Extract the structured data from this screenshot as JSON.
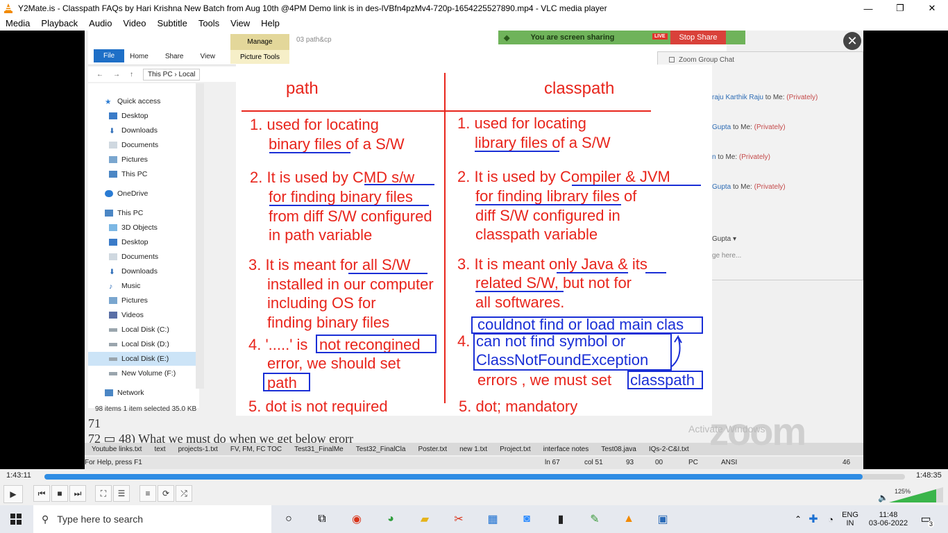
{
  "window": {
    "title": "Y2Mate.is - Classpath FAQs by Hari Krishna  New Batch from Aug 10th @4PM  Demo link is in des-lVBfn4pzMv4-720p-1654225527890.mp4 - VLC media player",
    "minimize": "—",
    "maximize": "❐",
    "close": "✕"
  },
  "menu": [
    "Media",
    "Playback",
    "Audio",
    "Video",
    "Subtitle",
    "Tools",
    "View",
    "Help"
  ],
  "explorer": {
    "manage": "Manage",
    "picture_tools": "Picture Tools",
    "folder_title": "03 path&cp",
    "tabs": [
      "File",
      "Home",
      "Share",
      "View"
    ],
    "address": [
      "This PC",
      "Local"
    ],
    "nav_items": [
      {
        "label": "Quick access",
        "icon": "star-icon"
      },
      {
        "label": "Desktop",
        "icon": "desktop-icon"
      },
      {
        "label": "Downloads",
        "icon": "download-icon"
      },
      {
        "label": "Documents",
        "icon": "document-icon"
      },
      {
        "label": "Pictures",
        "icon": "pictures-icon"
      },
      {
        "label": "This PC",
        "icon": "pc-icon"
      },
      {
        "label": "OneDrive",
        "icon": "cloud-icon"
      },
      {
        "label": "This PC",
        "icon": "pc-icon"
      },
      {
        "label": "3D Objects",
        "icon": "cube-icon"
      },
      {
        "label": "Desktop",
        "icon": "desktop-icon"
      },
      {
        "label": "Documents",
        "icon": "document-icon"
      },
      {
        "label": "Downloads",
        "icon": "download-icon"
      },
      {
        "label": "Music",
        "icon": "music-icon"
      },
      {
        "label": "Pictures",
        "icon": "pictures-icon"
      },
      {
        "label": "Videos",
        "icon": "video-icon"
      },
      {
        "label": "Local Disk (C:)",
        "icon": "disk-icon"
      },
      {
        "label": "Local Disk (D:)",
        "icon": "disk-icon"
      },
      {
        "label": "Local Disk (E:)",
        "icon": "disk-icon"
      },
      {
        "label": "New Volume (F:)",
        "icon": "disk-icon"
      },
      {
        "label": "Network",
        "icon": "network-icon"
      }
    ],
    "status": "98 items     1 item selected  35.0 KB"
  },
  "notepad": {
    "line_71": "71",
    "line_72": "72 ▭ 48) What we must do when we get below erorr",
    "tabs": [
      "Youtube links.txt",
      "text",
      "projects-1.txt",
      "FV, FM, FC TOC",
      "Test31_FinalMe",
      "Test32_FinalCla",
      "Poster.txt",
      "new 1.txt",
      "Project.txt",
      "interface notes",
      "Test08.java",
      "IQs-2-C&I.txt"
    ],
    "help": "For Help, press F1",
    "ln": "ln 67",
    "col": "col 51",
    "n93": "93",
    "n00": "00",
    "pc": "PC",
    "ansi": "ANSI",
    "n46": "46"
  },
  "zoom": {
    "sharing": "You are screen sharing",
    "live": "LIVE",
    "stop_share": "Stop Share",
    "close": "✕",
    "chat_title": "Zoom Group Chat",
    "messages": [
      {
        "from": "raju Karthik Raju",
        "to": "to Me:",
        "tag": "(Privately)"
      },
      {
        "from": "Gupta",
        "to": "to Me:",
        "tag": "(Privately)"
      },
      {
        "from": "n",
        "to": "to Me:",
        "tag": "(Privately)"
      },
      {
        "from": "Gupta",
        "to": "to Me:",
        "tag": "(Privately)"
      }
    ],
    "recipient": "Gupta ▾",
    "type_here": "ge here...",
    "logo": "zoom",
    "activate": "Activate Windows"
  },
  "board": {
    "head_left": "path",
    "head_right": "classpath",
    "left": [
      "1. used for locating",
      "binary files of a S/W",
      "2. It is used by CMD s/w",
      "for finding binary files",
      "from diff S/W configured",
      "in path variable",
      "3. It is meant for all S/W",
      "installed in our computer",
      "including OS for",
      "finding binary files",
      "4. '.....' is",
      "not recongined",
      "error, we should set",
      "path",
      "5. dot is not required"
    ],
    "right": [
      "1. used for locating",
      "library files of a S/W",
      "2. It is used by Compiler & JVM",
      "for finding library files of",
      "diff S/W configured in",
      "classpath variable",
      "3. It is meant only Java & its",
      "related S/W, but not for",
      "all softwares.",
      "couldnot find or load main clas",
      "4.",
      "can not find symbol   or",
      "ClassNotFoundException",
      "errors , we must set",
      "classpath",
      "5. dot;  mandatory"
    ]
  },
  "player": {
    "elapsed": "1:43:11",
    "total": "1:48:35",
    "progress": 0.951,
    "volume": "125%",
    "buttons": [
      "play-icon",
      "prev-icon",
      "stop-icon",
      "next-icon",
      "fullscreen-icon",
      "extended-settings-icon",
      "playlist-icon",
      "loop-icon",
      "shuffle-icon"
    ]
  },
  "taskbar": {
    "search_placeholder": "Type here to search",
    "lang": "ENG",
    "region": "IN",
    "time": "11:48",
    "date": "03-06-2022",
    "notifications": "3"
  },
  "colors": {
    "ink_red": "#e8251c",
    "ink_blue": "#1a2fd6",
    "vlc_progress": "#2f8de4",
    "taskbar": "#e6e9ef"
  }
}
